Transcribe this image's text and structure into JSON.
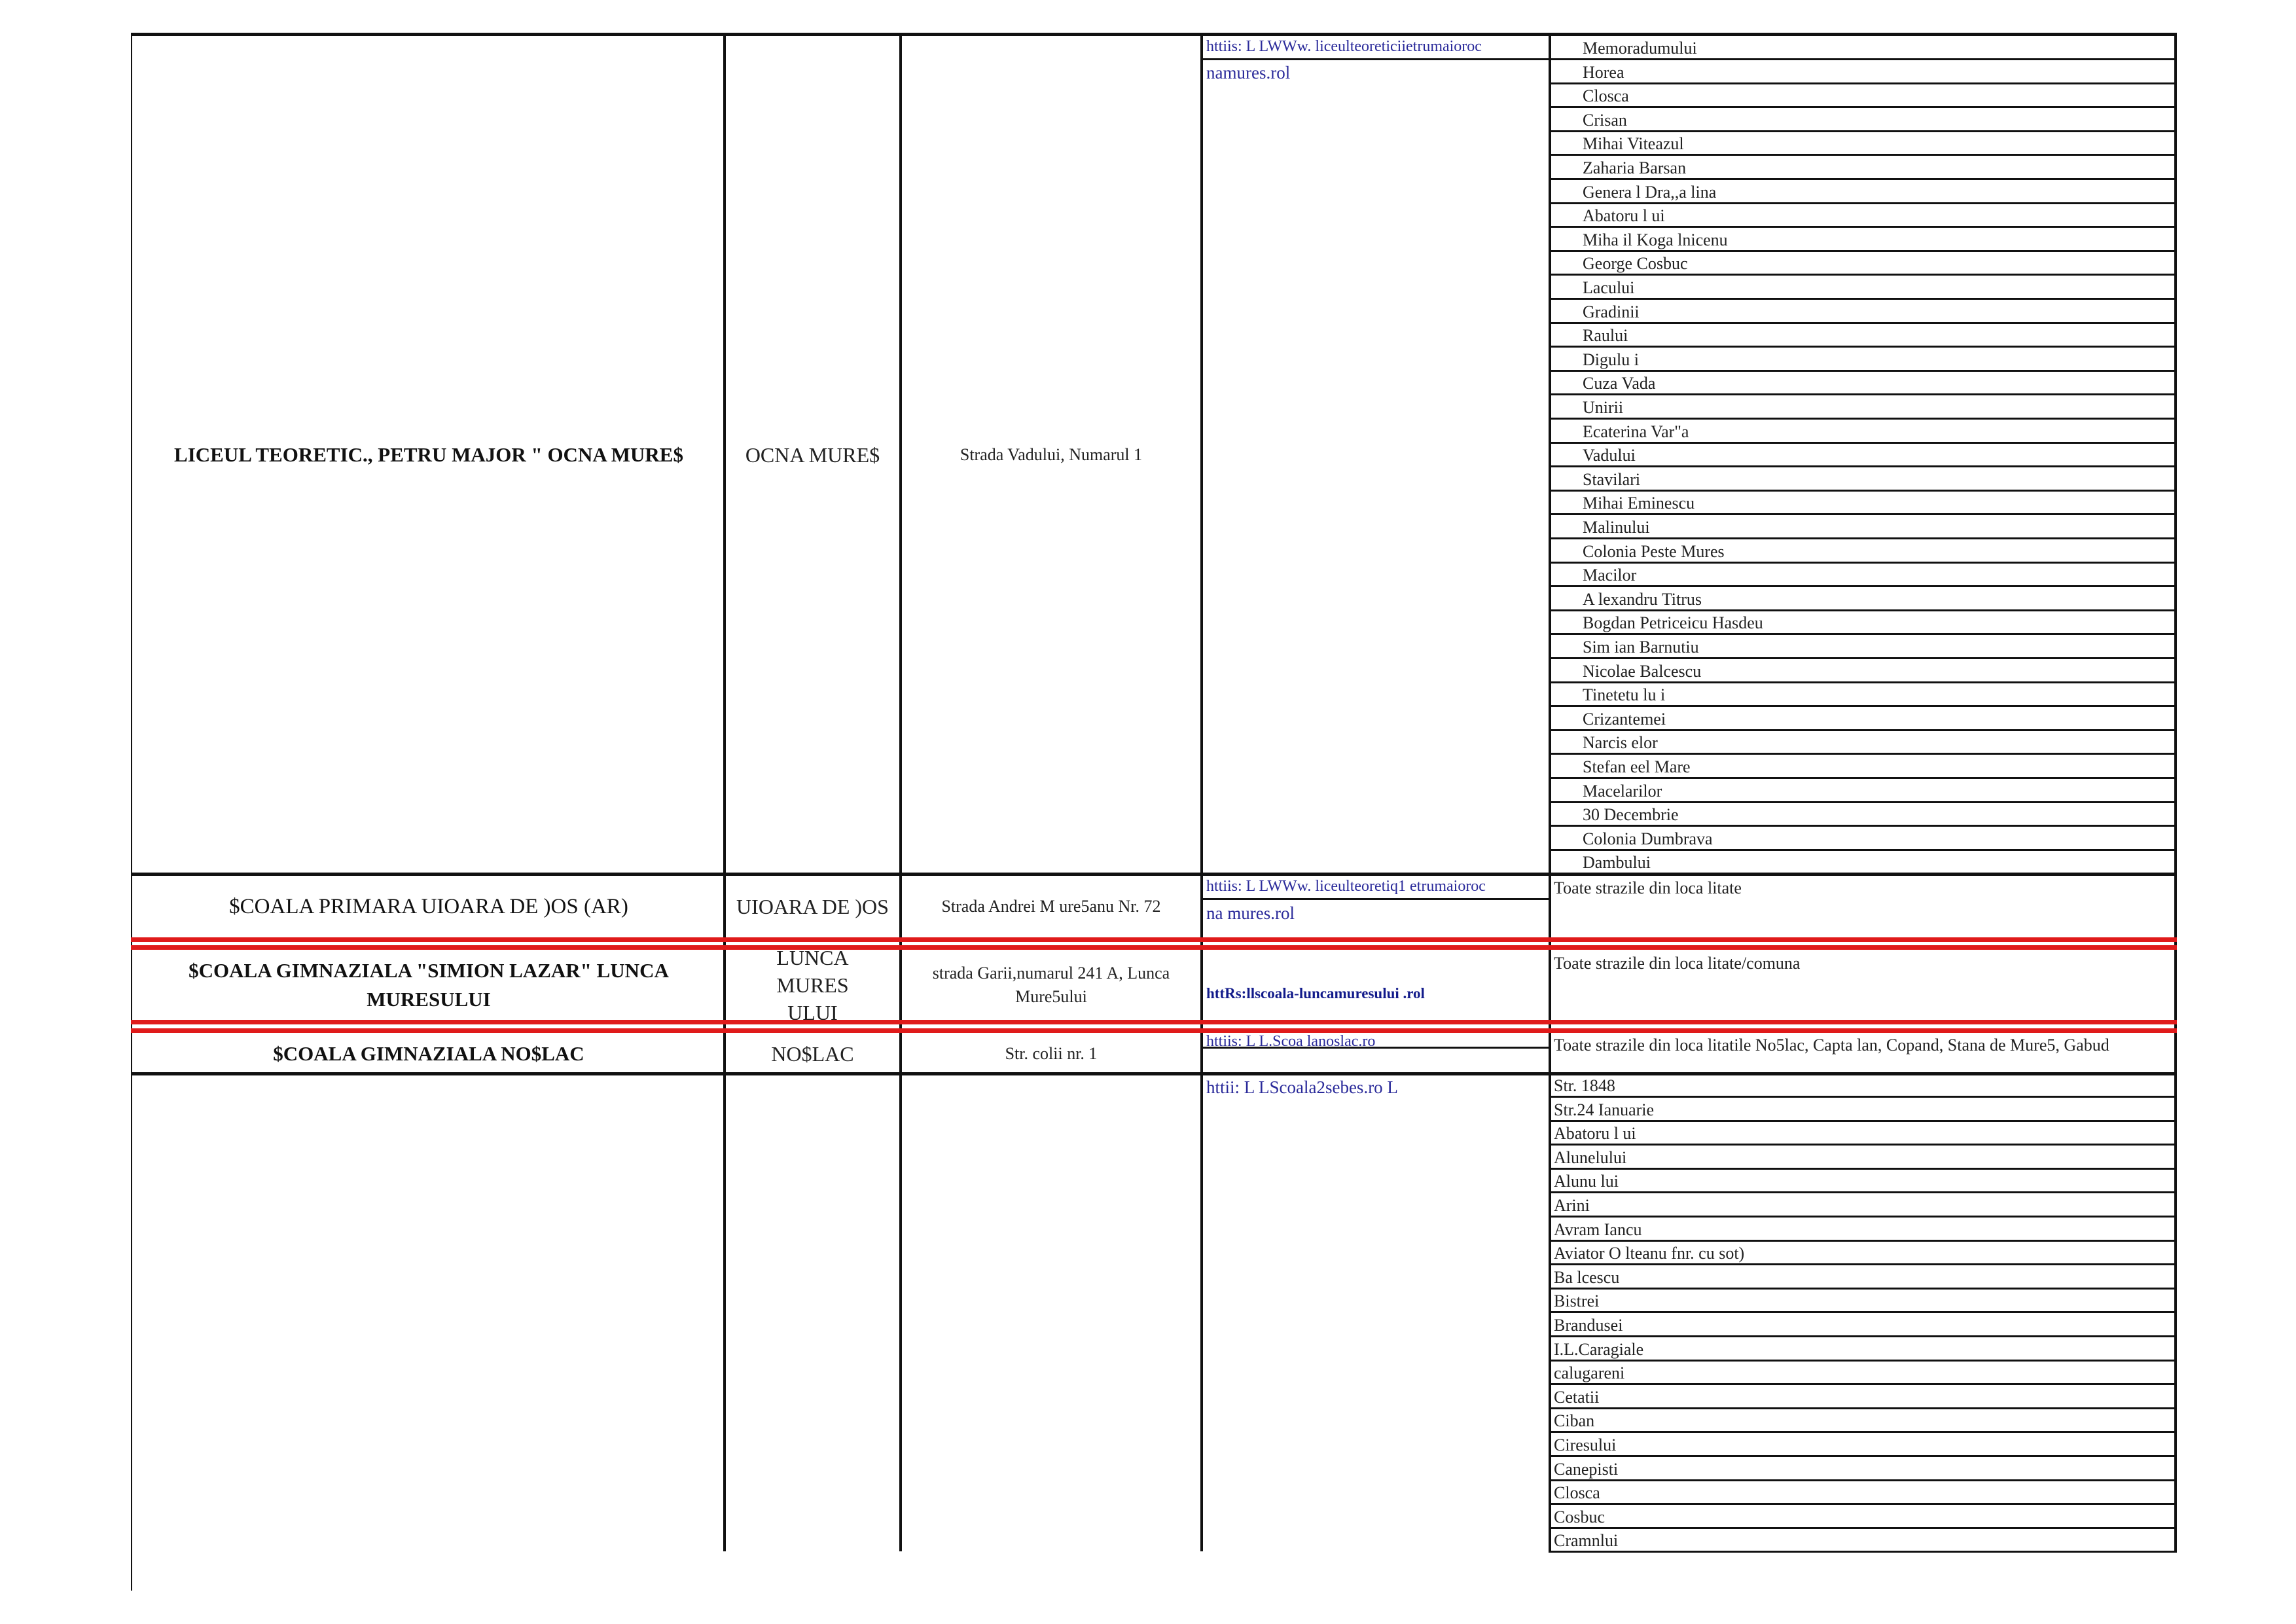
{
  "rows": {
    "liceu": {
      "name": "LICEUL TEORETIC., PETRU MAJOR \" OCNA MURE$",
      "locality": "OCNA MURE$",
      "address": "Strada Vadului, Numarul 1",
      "link_line1": "httiis:  L  LWWw.  liceulteoreticiietrumaioroc",
      "link_line2": "namures.rol",
      "streets": [
        "Memoradumului",
        "Horea",
        "Closca",
        "Crisan",
        "Mihai Viteazul",
        "Zaharia Barsan",
        "Genera l   Dra,,a lina",
        "Abatoru l ui",
        "Miha il  Koga lnicenu",
        "George Cosbuc",
        "Lacului",
        "Gradinii",
        "Raului",
        "Digulu i",
        "Cuza Vada",
        "Unirii",
        "Ecaterina  Var\"a",
        "Vadului",
        "Stavilari",
        "Mihai  Eminescu",
        "Malinului",
        "Colonia Peste Mures",
        "Macilor",
        "A lexandru Titrus",
        "Bogdan Petriceicu Hasdeu",
        "Sim ian Barnutiu",
        "Nicolae Balcescu",
        "Tinetetu lu i",
        "Crizantemei",
        "Narcis elor",
        "Stefan eel  Mare",
        "Macelarilor",
        "30 Decembrie",
        "Colonia Dumbrava",
        "Dambului"
      ]
    },
    "uioara": {
      "name": "$COALA PRIMARA UIOARA DE )OS (AR)",
      "locality": "UIOARA DE )OS",
      "address": "Strada Andrei  M ure5anu  Nr.  72",
      "link_line1": "httiis:  L  LWWw.  liceulteoretiq1 etrumaioroc",
      "link_line2": "na mures.rol",
      "note": "Toate strazile din loca litate"
    },
    "lunca": {
      "name": "$COALA GIMNAZIALA \"SIMION LAZAR\" LUNCA MURESULUI",
      "locality": "LUNCA MURES ULUI",
      "address": "strada Garii,numarul 241 A, Lunca Mure5ului",
      "link": "httRs:llscoala-luncamuresului  .rol",
      "note": "Toate strazile din loca litate/comuna"
    },
    "noslac": {
      "name": "$COALA GIMNAZIALA NO$LAC",
      "locality": "NO$LAC",
      "address": "Str.   colii nr. 1",
      "link": "httiis: L L.Scoa lanoslac.ro",
      "note": "Toate strazile din loca litatile No5lac, Capta lan, Copand, Stana de Mure5, Gabud"
    },
    "sebes": {
      "link": "httii:  L  LScoala2sebes.ro  L",
      "streets": [
        "Str. 1848",
        "Str.24 Ianuarie",
        "Abatoru l ui",
        "Alunelului",
        "Alunu lui",
        "Arini",
        "Avram  Iancu",
        "Aviator  O lteanu fnr. cu sot)",
        "Ba lcescu",
        "Bistrei",
        "Brandusei",
        "I.L.Caragiale",
        "calugareni",
        "Cetatii",
        "Ciban",
        "Ciresului",
        "Canepisti",
        "Closca",
        "Cosbuc",
        "Cramnlui"
      ]
    }
  }
}
